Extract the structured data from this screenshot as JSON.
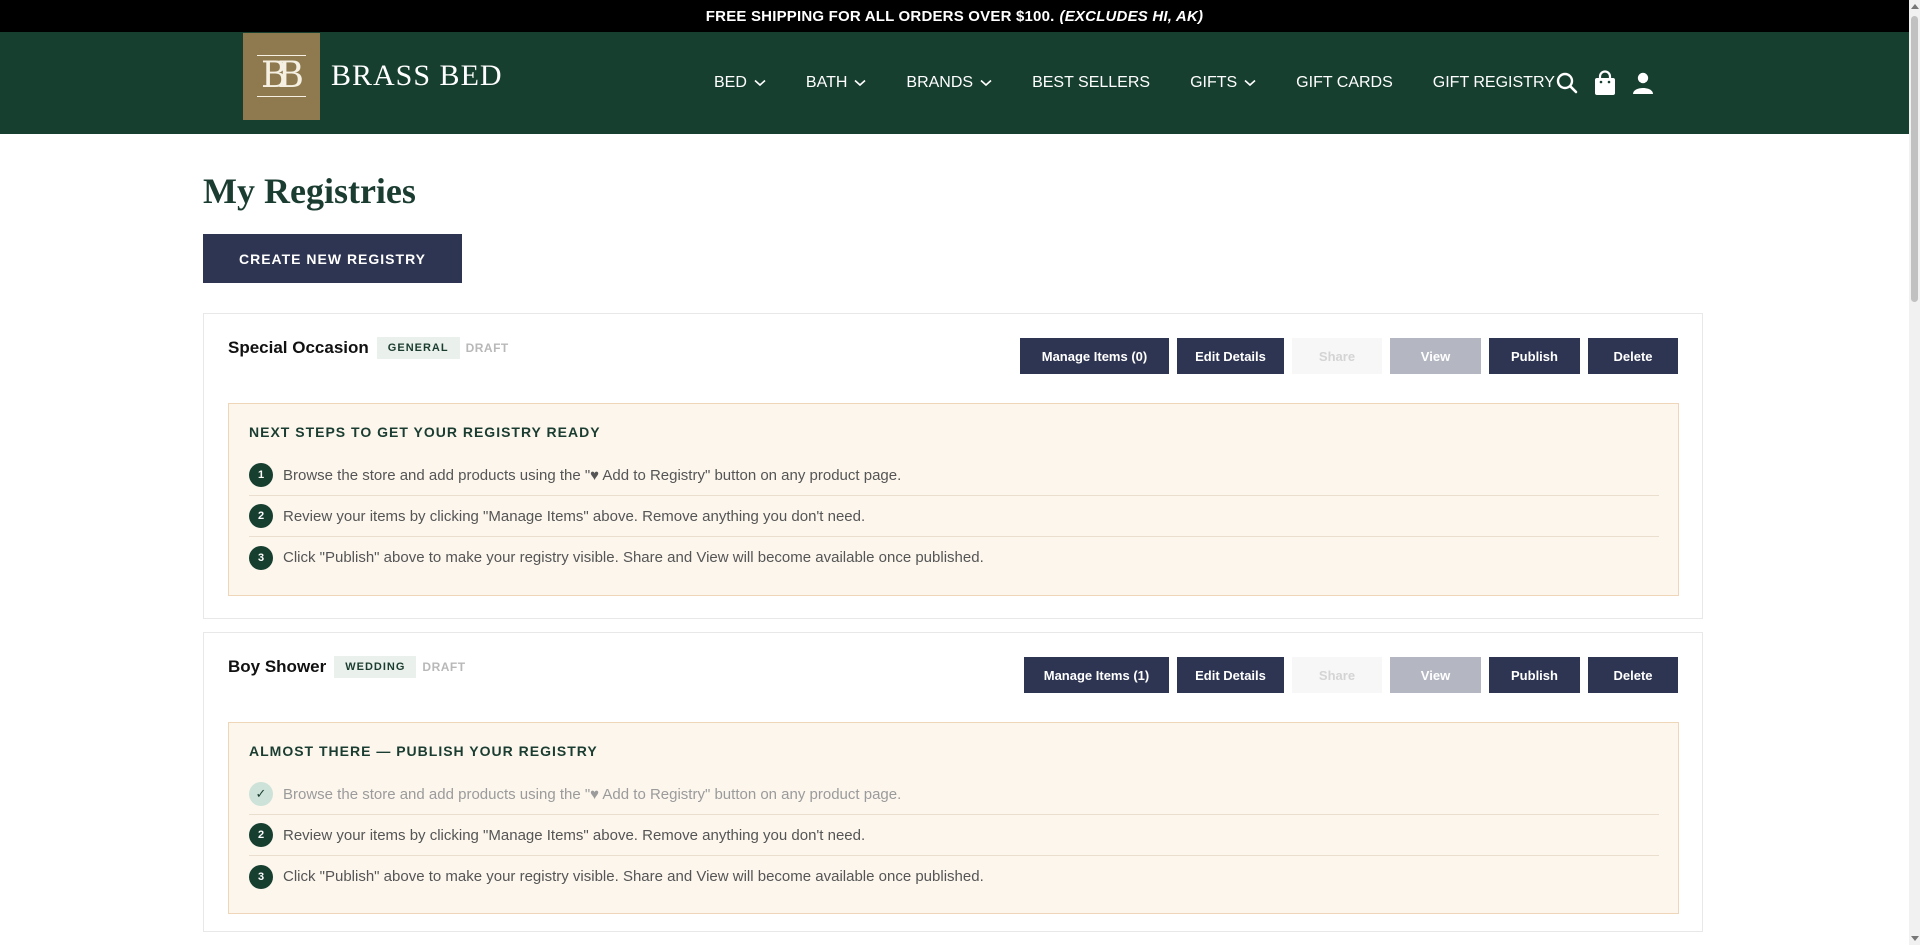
{
  "announcement": {
    "text": "FREE SHIPPING FOR ALL ORDERS OVER $100.",
    "emphasis": "(EXCLUDES HI, AK)"
  },
  "brand": {
    "monogram": "BB",
    "name": "BRASS BED"
  },
  "nav": {
    "items": [
      {
        "label": "BED",
        "dropdown": true
      },
      {
        "label": "BATH",
        "dropdown": true
      },
      {
        "label": "BRANDS",
        "dropdown": true
      },
      {
        "label": "BEST SELLERS",
        "dropdown": false
      },
      {
        "label": "GIFTS",
        "dropdown": true
      },
      {
        "label": "GIFT CARDS",
        "dropdown": false
      },
      {
        "label": "GIFT REGISTRY",
        "dropdown": false
      }
    ],
    "icons": [
      "search-icon",
      "shopping-bag-icon",
      "account-icon"
    ]
  },
  "page": {
    "title": "My Registries",
    "create_label": "CREATE NEW REGISTRY"
  },
  "registries": [
    {
      "name": "Special Occasion",
      "type": "GENERAL",
      "status": "DRAFT",
      "actions": {
        "manage": "Manage Items (0)",
        "edit": "Edit Details",
        "share": "Share",
        "view": "View",
        "publish": "Publish",
        "delete": "Delete"
      },
      "steps_title": "NEXT STEPS TO GET YOUR REGISTRY READY",
      "steps": [
        {
          "marker": "1",
          "done": false,
          "text": "Browse the store and add products using the \"♥ Add to Registry\" button on any product page."
        },
        {
          "marker": "2",
          "done": false,
          "text": "Review your items by clicking \"Manage Items\" above. Remove anything you don't need."
        },
        {
          "marker": "3",
          "done": false,
          "text": "Click \"Publish\" above to make your registry visible. Share and View will become available once published."
        }
      ]
    },
    {
      "name": "Boy Shower",
      "type": "WEDDING",
      "status": "DRAFT",
      "actions": {
        "manage": "Manage Items (1)",
        "edit": "Edit Details",
        "share": "Share",
        "view": "View",
        "publish": "Publish",
        "delete": "Delete"
      },
      "steps_title": "ALMOST THERE — PUBLISH YOUR REGISTRY",
      "steps": [
        {
          "marker": "✓",
          "done": true,
          "text": "Browse the store and add products using the \"♥ Add to Registry\" button on any product page."
        },
        {
          "marker": "2",
          "done": false,
          "text": "Review your items by clicking \"Manage Items\" above. Remove anything you don't need."
        },
        {
          "marker": "3",
          "done": false,
          "text": "Click \"Publish\" above to make your registry visible. Share and View will become available once published."
        }
      ]
    }
  ],
  "colors": {
    "header": "#173f30",
    "button": "#2e3552",
    "logo_bg": "#8e7a4e",
    "steps_bg": "#fcf6ed"
  }
}
